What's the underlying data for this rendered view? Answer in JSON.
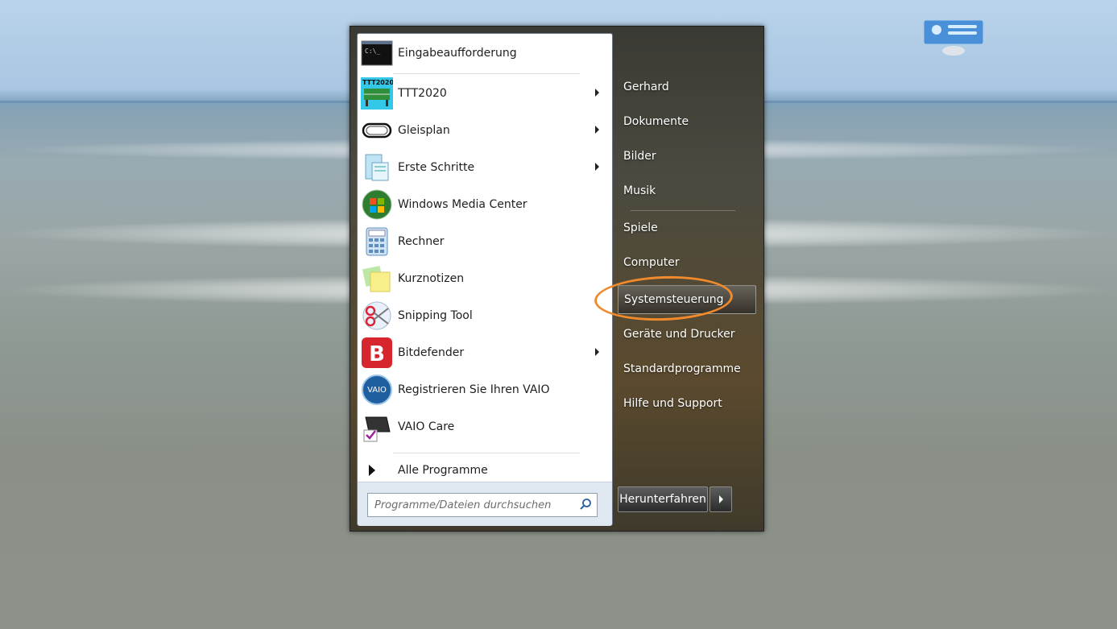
{
  "left_pane": {
    "programs": [
      {
        "label": "Eingabeaufforderung",
        "icon": "command-prompt-icon",
        "has_submenu": false
      },
      {
        "label": "TTT2020",
        "icon": "ttt2020-icon",
        "icon_text": "TTT2020",
        "has_submenu": true
      },
      {
        "label": "Gleisplan",
        "icon": "track-plan-icon",
        "has_submenu": true
      },
      {
        "label": "Erste Schritte",
        "icon": "getting-started-icon",
        "has_submenu": true
      },
      {
        "label": "Windows Media Center",
        "icon": "media-center-icon",
        "has_submenu": false
      },
      {
        "label": "Rechner",
        "icon": "calculator-icon",
        "has_submenu": false
      },
      {
        "label": "Kurznotizen",
        "icon": "sticky-notes-icon",
        "has_submenu": false
      },
      {
        "label": "Snipping Tool",
        "icon": "snipping-tool-icon",
        "has_submenu": false
      },
      {
        "label": "Bitdefender",
        "icon": "bitdefender-icon",
        "icon_text": "B",
        "has_submenu": true
      },
      {
        "label": "Registrieren Sie Ihren VAIO",
        "icon": "vaio-register-icon",
        "icon_text": "VAIO",
        "has_submenu": false
      },
      {
        "label": "VAIO Care",
        "icon": "vaio-care-icon",
        "has_submenu": false
      }
    ],
    "all_programs_label": "Alle Programme",
    "search": {
      "placeholder": "Programme/Dateien durchsuchen",
      "value": ""
    }
  },
  "right_pane": {
    "items": [
      {
        "label": "Gerhard"
      },
      {
        "label": "Dokumente"
      },
      {
        "label": "Bilder"
      },
      {
        "label": "Musik"
      },
      {
        "label": "Spiele"
      },
      {
        "label": "Computer"
      },
      {
        "label": "Systemsteuerung",
        "highlighted": true
      },
      {
        "label": "Geräte und Drucker"
      },
      {
        "label": "Standardprogramme"
      },
      {
        "label": "Hilfe und Support"
      }
    ],
    "shutdown_label": "Herunterfahren"
  },
  "colors": {
    "annotation_ellipse": "#f08a2c",
    "bitdefender_red": "#d6252c",
    "ttt_cyan": "#33c7e8"
  }
}
